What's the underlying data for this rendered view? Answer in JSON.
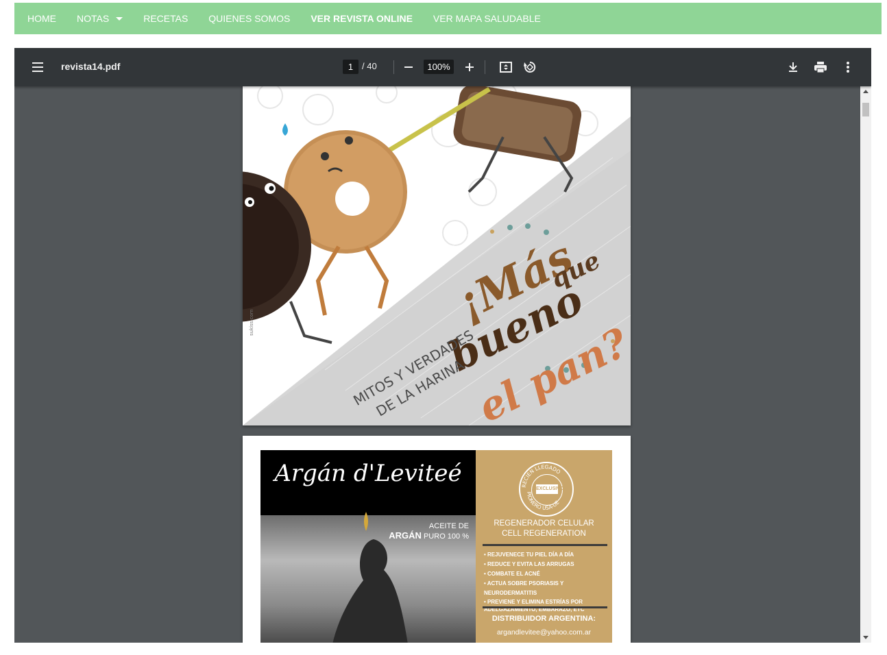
{
  "nav": {
    "items": [
      {
        "label": "HOME",
        "bold": false
      },
      {
        "label": "NOTAS",
        "bold": false,
        "has_dropdown": true
      },
      {
        "label": "RECETAS",
        "bold": false
      },
      {
        "label": "QUIENES SOMOS",
        "bold": false
      },
      {
        "label": "VER REVISTA ONLINE",
        "bold": true
      },
      {
        "label": "VER MAPA SALUDABLE",
        "bold": false
      }
    ],
    "bg_color": "#8fd596"
  },
  "viewer": {
    "title": "revista14.pdf",
    "page_current": "1",
    "page_total": "/ 40",
    "zoom": "100%",
    "toolbar_color": "#323639",
    "bg_color": "#525659"
  },
  "page1": {
    "title_line1": "¡Más",
    "title_line2": "bueno",
    "title_line3": "que",
    "title_line4": "el pan?",
    "subtitle_line1": "MITOS Y VERDADES",
    "subtitle_line2": "DE LA HARINA",
    "credit": "sukiss.com"
  },
  "page2": {
    "brand": "Argán d'Leviteé",
    "aceite_line1": "ACEITE DE",
    "aceite_line2_strong": "ARGÁN",
    "aceite_line2_rest": "PURO 100 %",
    "seal_top": "RECIEN LLEGADO",
    "seal_center": "EXCLUSIVO",
    "seal_bottom": "PIONERO USA-UE",
    "reg_line1": "REGENERADOR CELULAR",
    "reg_line2": "CELL REGENERATION",
    "bullets": [
      "REJUVENECE TU PIEL DÍA A DÍA",
      "REDUCE Y EVITA LAS ARRUGAS",
      "COMBATE EL ACNÉ",
      "ACTUA SOBRE PSORIASIS Y NEURODERMATITIS",
      "PREVIENE Y ELIMINA ESTRÍAS POR ADELGAZAMIENTO, EMBARAZO, ETC"
    ],
    "distribuidor": "DISTRIBUIDOR ARGENTINA:",
    "email": "argandlevitee@yahoo.com.ar"
  }
}
